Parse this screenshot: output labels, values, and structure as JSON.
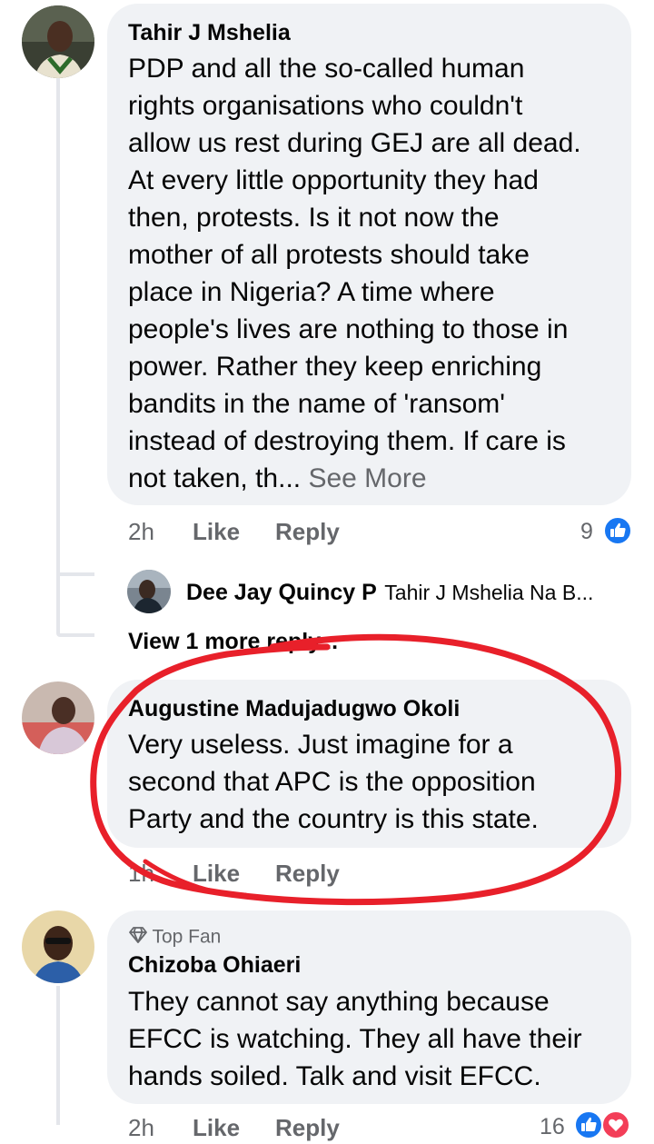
{
  "comments": [
    {
      "author": "Tahir J Mshelia",
      "text_lines": [
        "PDP and all the so-called human",
        "rights organisations who couldn't",
        "allow us rest during GEJ are all dead.",
        "At every little opportunity they had",
        "then, protests. Is it not now the",
        "mother of all protests should take",
        "place in Nigeria?  A time where",
        "people's lives are nothing to those in",
        "power. Rather they keep enriching",
        "bandits in the name of 'ransom'",
        "instead of destroying them. If care is"
      ],
      "last_line": "not taken, th...",
      "see_more": "See More",
      "time": "2h",
      "like": "Like",
      "reply": "Reply",
      "reaction_count": "9"
    },
    {
      "author": "Augustine Madujadugwo Okoli",
      "text_lines": [
        "Very useless. Just imagine for a",
        "second that APC is the opposition",
        "Party and the country is this state."
      ],
      "time": "1h",
      "like": "Like",
      "reply": "Reply"
    },
    {
      "badge": "Top Fan",
      "author": "Chizoba Ohiaeri",
      "text_lines": [
        "They cannot say anything because",
        "EFCC is watching. They all have their",
        "hands soiled. Talk and visit EFCC."
      ],
      "time": "2h",
      "like": "Like",
      "reply": "Reply",
      "reaction_count": "16"
    }
  ],
  "reply_preview": {
    "author": "Dee Jay Quincy P",
    "snippet": "Tahir J Mshelia Na B..."
  },
  "view_more_replies": "View 1 more reply...",
  "colors": {
    "bubble": "#f0f2f5",
    "muted": "#65676b",
    "like_blue": "#1877f2",
    "annotation_red": "#e8202a"
  }
}
